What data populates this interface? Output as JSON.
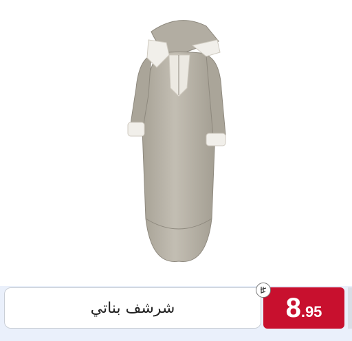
{
  "product": {
    "name": "شرشف بناتي",
    "price_integer": "8",
    "price_decimal": ".95",
    "currency_icon": "riyal-symbol-icon"
  },
  "colors": {
    "price_bg": "#c8102e",
    "garment": "#b8b3a8",
    "lace": "#f1efea",
    "page_bg": "#ffffff"
  }
}
